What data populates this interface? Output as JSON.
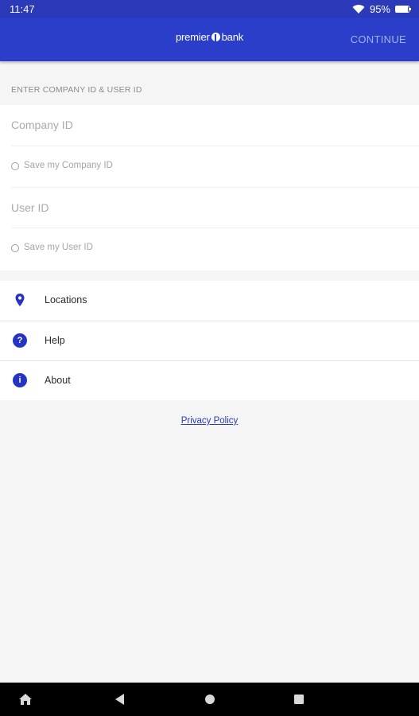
{
  "status_bar": {
    "time": "11:47",
    "battery_text": "95%",
    "battery_level": 0.95
  },
  "app_bar": {
    "brand_left": "premier",
    "brand_right": "bank",
    "continue_label": "CONTINUE"
  },
  "form": {
    "section_header": "ENTER COMPANY ID & USER ID",
    "company_id_placeholder": "Company ID",
    "save_company_label": "Save my Company ID",
    "user_id_placeholder": "User ID",
    "save_user_label": "Save my User ID"
  },
  "menu": {
    "items": [
      {
        "label": "Locations",
        "icon": "location-pin-icon"
      },
      {
        "label": "Help",
        "icon": "help-icon"
      },
      {
        "label": "About",
        "icon": "info-icon"
      }
    ]
  },
  "privacy_link": "Privacy Policy",
  "colors": {
    "primary": "#2b3ec9",
    "status_bar": "#2a3ab8",
    "icon_blue": "#2634c4",
    "link": "#2a3ab0"
  }
}
